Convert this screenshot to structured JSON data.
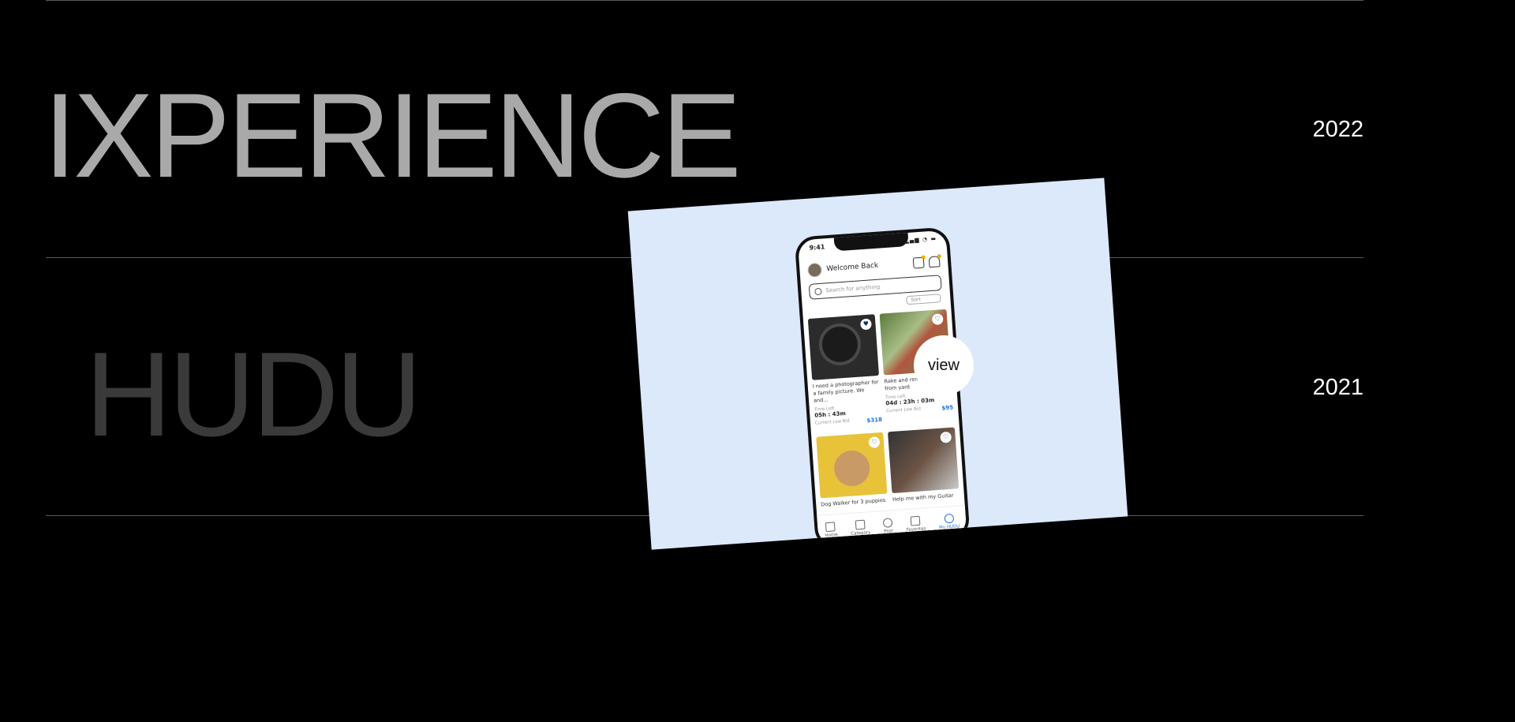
{
  "rows": [
    {
      "title": "IXPERIENCE",
      "year": "2022"
    },
    {
      "title": "HUDU",
      "year": "2021"
    }
  ],
  "preview": {
    "view_label": "view",
    "phone": {
      "time": "9:41",
      "greeting": "Welcome Back",
      "search_placeholder": "Search for anything",
      "sort_label": "Sort",
      "listings": [
        {
          "desc": "I need a photographer for a family picture. We and...",
          "time_left_label": "Time Left",
          "time_left": "05h : 43m",
          "bid_label": "Current Low Bid",
          "price": "$318",
          "favorited": true
        },
        {
          "desc": "Rake and remove leaves from yard",
          "time_left_label": "Time Left",
          "time_left": "04d : 23h : 03m",
          "bid_label": "Current Low Bid",
          "price": "$95",
          "favorited": false
        },
        {
          "desc": "Dog Walker for 3 puppies",
          "favorited": false
        },
        {
          "desc": "Help me with my Guitar",
          "favorited": false
        }
      ],
      "tabs": [
        {
          "label": "Home",
          "icon": "home-icon"
        },
        {
          "label": "Category",
          "icon": "menu-icon"
        },
        {
          "label": "Post",
          "icon": "plus-circle-icon"
        },
        {
          "label": "Favorites",
          "icon": "heart-icon"
        },
        {
          "label": "My HUDU",
          "icon": "user-icon",
          "active": true
        }
      ]
    }
  }
}
